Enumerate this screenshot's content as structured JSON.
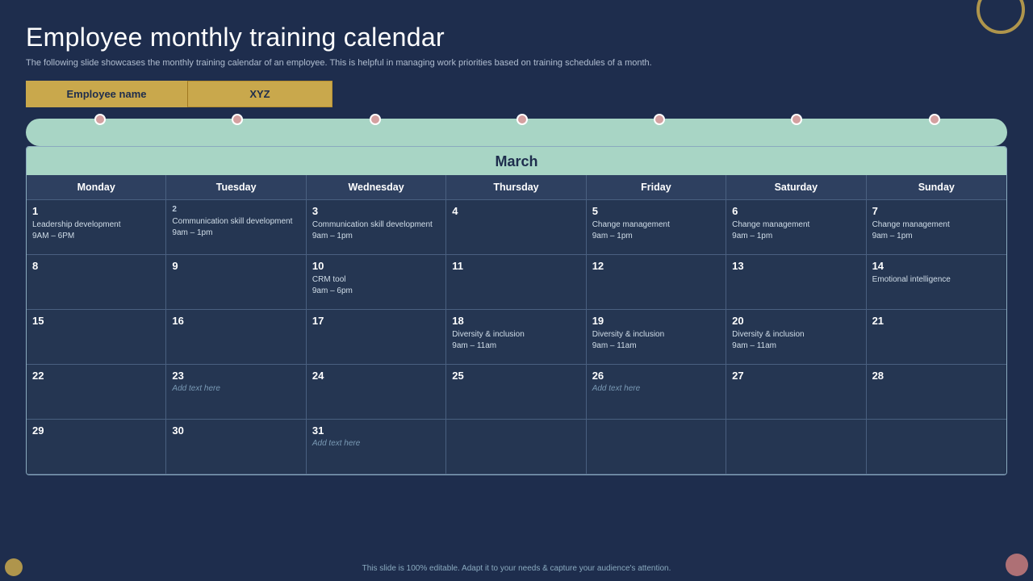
{
  "page": {
    "title": "Employee monthly training calendar",
    "subtitle": "The following slide showcases the monthly training calendar of an employee. This is helpful in managing work priorities based on training schedules of a month.",
    "footer": "This slide is 100% editable. Adapt it to your needs & capture your audience's attention."
  },
  "employee": {
    "label": "Employee name",
    "value": "XYZ"
  },
  "calendar": {
    "month": "March",
    "days": [
      "Monday",
      "Tuesday",
      "Wednesday",
      "Thursday",
      "Friday",
      "Saturday",
      "Sunday"
    ]
  },
  "cells": [
    {
      "date": "1",
      "event": "Leadership development\n9AM – 6PM",
      "small": false
    },
    {
      "date": "2",
      "event": "Communication skill development\n9am – 1pm",
      "small": true
    },
    {
      "date": "3",
      "event": "Communication skill development\n9am – 1pm",
      "small": false
    },
    {
      "date": "4",
      "event": "",
      "small": false
    },
    {
      "date": "5",
      "event": "Change management\n9am – 1pm",
      "small": false
    },
    {
      "date": "6",
      "event": "Change management\n9am – 1pm",
      "small": false
    },
    {
      "date": "7",
      "event": "Change management\n9am – 1pm",
      "small": false
    },
    {
      "date": "8",
      "event": "",
      "small": false
    },
    {
      "date": "9",
      "event": "",
      "small": false
    },
    {
      "date": "10",
      "event": "CRM tool\n9am – 6pm",
      "small": false
    },
    {
      "date": "11",
      "event": "",
      "small": false
    },
    {
      "date": "12",
      "event": "",
      "small": false
    },
    {
      "date": "13",
      "event": "",
      "small": false
    },
    {
      "date": "14",
      "event": "Emotional intelligence",
      "small": false
    },
    {
      "date": "15",
      "event": "",
      "small": false
    },
    {
      "date": "16",
      "event": "",
      "small": false
    },
    {
      "date": "17",
      "event": "",
      "small": false
    },
    {
      "date": "18",
      "event": "Diversity & inclusion\n9am – 11am",
      "small": false
    },
    {
      "date": "19",
      "event": "Diversity & inclusion\n9am – 11am",
      "small": false
    },
    {
      "date": "20",
      "event": "Diversity & inclusion\n9am – 11am",
      "small": false
    },
    {
      "date": "21",
      "event": "",
      "small": false
    },
    {
      "date": "22",
      "event": "",
      "small": false
    },
    {
      "date": "23",
      "event": "Add text here",
      "small": false,
      "placeholder": true
    },
    {
      "date": "24",
      "event": "",
      "small": false
    },
    {
      "date": "25",
      "event": "",
      "small": false
    },
    {
      "date": "26",
      "event": "Add text here",
      "small": false,
      "placeholder": true
    },
    {
      "date": "27",
      "event": "",
      "small": false
    },
    {
      "date": "28",
      "event": "",
      "small": false
    },
    {
      "date": "29",
      "event": "",
      "small": false
    },
    {
      "date": "30",
      "event": "",
      "small": false
    },
    {
      "date": "31",
      "event": "Add text here",
      "small": false,
      "placeholder": true
    },
    {
      "date": "",
      "event": "",
      "small": false,
      "empty": true
    },
    {
      "date": "",
      "event": "",
      "small": false,
      "empty": true
    },
    {
      "date": "",
      "event": "",
      "small": false,
      "empty": true
    },
    {
      "date": "",
      "event": "",
      "small": false,
      "empty": true
    }
  ],
  "dots": [
    {
      "left": "7%"
    },
    {
      "left": "21%"
    },
    {
      "left": "35%"
    },
    {
      "left": "50%"
    },
    {
      "left": "64%"
    },
    {
      "left": "78%"
    },
    {
      "left": "92%"
    }
  ]
}
